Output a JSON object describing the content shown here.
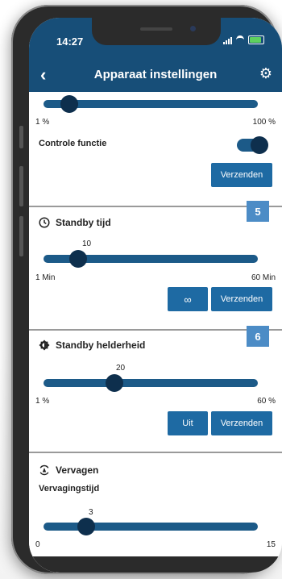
{
  "status": {
    "time": "14:27"
  },
  "header": {
    "title": "Apparaat instellingen"
  },
  "brightness_top": {
    "min_label": "1 %",
    "max_label": "100 %",
    "level": 0.12
  },
  "controle": {
    "label": "Controle functie",
    "enabled": true,
    "send_label": "Verzenden"
  },
  "standby_tijd": {
    "badge": "5",
    "title": "Standby tijd",
    "value": "10",
    "min_label": "1 Min",
    "max_label": "60 Min",
    "level": 0.16,
    "infinity_label": "∞",
    "send_label": "Verzenden"
  },
  "standby_helderheid": {
    "badge": "6",
    "title": "Standby helderheid",
    "value": "20",
    "min_label": "1 %",
    "max_label": "60 %",
    "level": 0.33,
    "off_label": "Uit",
    "send_label": "Verzenden"
  },
  "vervagen": {
    "title": "Vervagen",
    "sub_label": "Vervagingstijd",
    "value": "3",
    "min_label": "0",
    "max_label": "15",
    "level": 0.2
  },
  "colors": {
    "primary": "#174e78",
    "button": "#1e6aa3",
    "thumb": "#0e2f4d",
    "badge": "#4c8cc6"
  }
}
